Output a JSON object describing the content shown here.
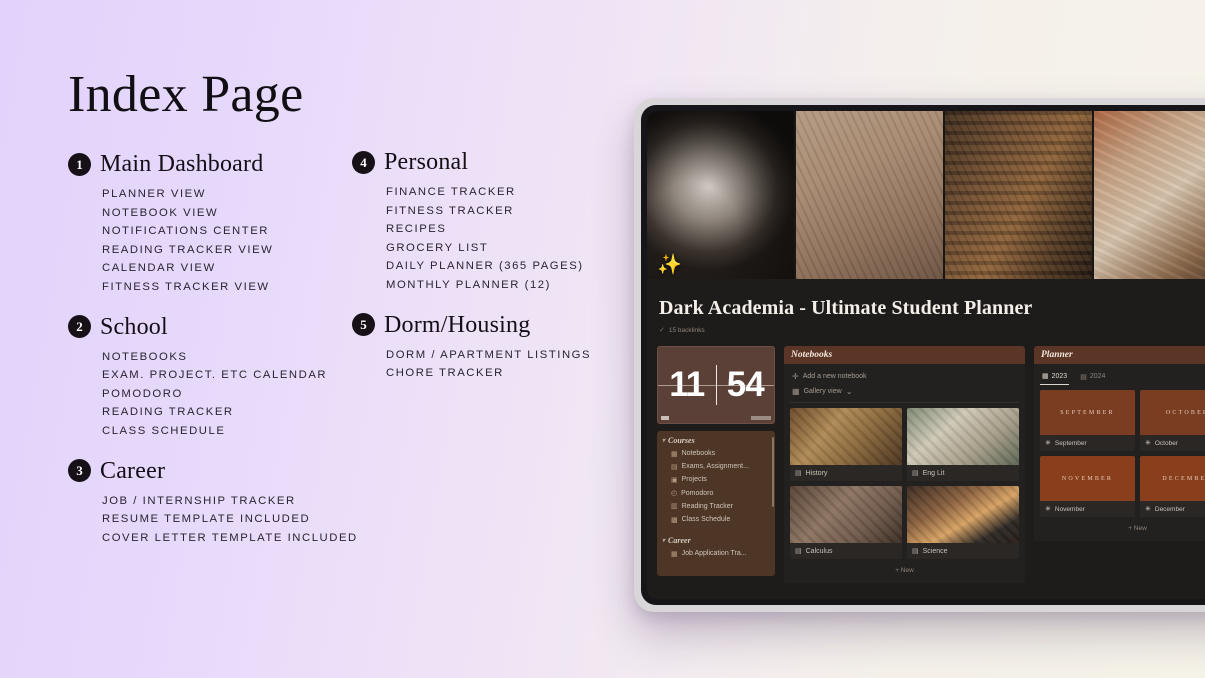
{
  "theme": {
    "bg_left": "#e3d2fb",
    "bg_right": "#f6f3e9",
    "badge_bg": "#171017",
    "accent_rust": "#5b3526",
    "screen_bg": "#1e1c1b"
  },
  "index": {
    "title": "Index Page",
    "columns": [
      {
        "sections": [
          {
            "number": "1",
            "title": "Main Dashboard",
            "items": [
              "PLANNER VIEW",
              "NOTEBOOK VIEW",
              "NOTIFICATIONS CENTER",
              "READING TRACKER VIEW",
              "CALENDAR VIEW",
              "FITNESS TRACKER VIEW"
            ]
          },
          {
            "number": "2",
            "title": "School",
            "items": [
              "NOTEBOOKS",
              "EXAM. PROJECT. ETC CALENDAR",
              "POMODORO",
              "READING TRACKER",
              "CLASS SCHEDULE"
            ]
          },
          {
            "number": "3",
            "title": "Career",
            "items": [
              "JOB / INTERNSHIP TRACKER",
              "RESUME TEMPLATE INCLUDED",
              "COVER LETTER TEMPLATE INCLUDED"
            ]
          }
        ]
      },
      {
        "sections": [
          {
            "number": "4",
            "title": "Personal",
            "items": [
              "FINANCE TRACKER",
              "FITNESS TRACKER",
              "RECIPES",
              "GROCERY LIST",
              "DAILY PLANNER (365 PAGES)",
              "MONTHLY PLANNER (12)"
            ]
          },
          {
            "number": "5",
            "title": "Dorm/Housing",
            "items": [
              "DORM / APARTMENT LISTINGS",
              "CHORE TRACKER"
            ]
          }
        ]
      }
    ]
  },
  "tablet": {
    "hero": {
      "panes": [
        "statue-photo",
        "sketch-photo",
        "library-photo",
        "books-photo"
      ],
      "wand_icon": "✨"
    },
    "doc_title": "Dark Academia - Ultimate Student Planner",
    "backlinks": "15 backlinks",
    "backlinks_icon": "✓",
    "clock": {
      "hours": "11",
      "minutes": "54"
    },
    "sidebar": {
      "groups": [
        {
          "label": "Courses",
          "caret": "▾",
          "items": [
            {
              "label": "Notebooks",
              "icon": "▦"
            },
            {
              "label": "Exams, Assignment...",
              "icon": "▤"
            },
            {
              "label": "Projects",
              "icon": "▣"
            },
            {
              "label": "Pomodoro",
              "icon": "◴"
            },
            {
              "label": "Reading Tracker",
              "icon": "▥"
            },
            {
              "label": "Class Schedule",
              "icon": "▩"
            }
          ]
        },
        {
          "label": "Career",
          "caret": "▾",
          "items": [
            {
              "label": "Job Application Tra...",
              "icon": "▦"
            }
          ]
        }
      ]
    },
    "notebooks": {
      "header": "Notebooks",
      "add_label": "Add a new notebook",
      "add_icon": "✛",
      "view_label": "Gallery view",
      "view_icon": "▦",
      "view_caret": "⌄",
      "cards": [
        {
          "label": "History",
          "icon": "▤",
          "thumb": "old-books-photo"
        },
        {
          "label": "Eng Lit",
          "icon": "▤",
          "thumb": "typewriter-photo"
        },
        {
          "label": "Calculus",
          "icon": "▤",
          "thumb": "statue-relief-photo"
        },
        {
          "label": "Science",
          "icon": "▤",
          "thumb": "apothecary-photo"
        }
      ],
      "new_label": "+ New"
    },
    "planner": {
      "header": "Planner",
      "tabs": [
        {
          "label": "2023",
          "icon": "▦",
          "active": true
        },
        {
          "label": "2024",
          "icon": "▤",
          "active": false
        }
      ],
      "months": [
        {
          "cover": "SEPTEMBER",
          "label": "September",
          "icon": "✳"
        },
        {
          "cover": "OCTOBER",
          "label": "October",
          "icon": "✳"
        },
        {
          "cover": "NOVEMBER",
          "label": "November",
          "icon": "✳"
        },
        {
          "cover": "DECEMBER",
          "label": "December",
          "icon": "✳"
        }
      ],
      "new_label": "+ New"
    }
  }
}
